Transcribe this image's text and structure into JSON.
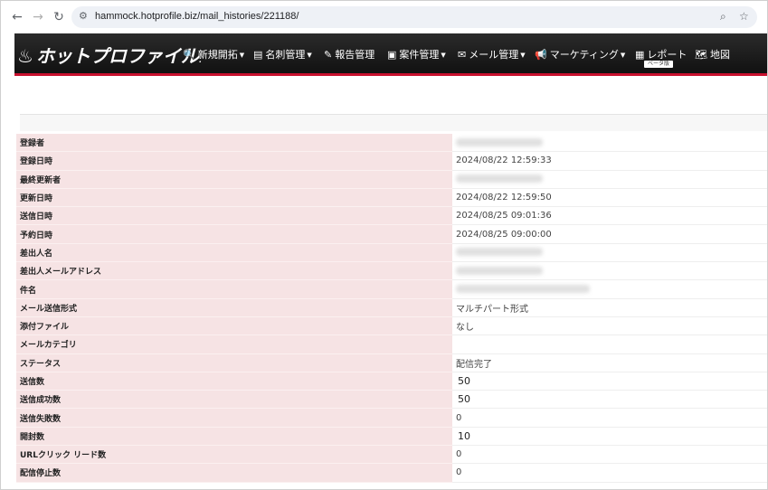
{
  "browser": {
    "url": "hammock.hotprofile.biz/mail_histories/221188/"
  },
  "app": {
    "logo": "ホットプロファイル",
    "menu": [
      {
        "label": "新規開拓",
        "icon": "search-doc-icon",
        "has_dropdown": true
      },
      {
        "label": "名刺管理",
        "icon": "card-icon",
        "has_dropdown": true
      },
      {
        "label": "報告管理",
        "icon": "edit-icon",
        "has_dropdown": false
      },
      {
        "label": "案件管理",
        "icon": "briefcase-icon",
        "has_dropdown": true
      },
      {
        "label": "メール管理",
        "icon": "mail-icon",
        "has_dropdown": true
      },
      {
        "label": "マーケティング",
        "icon": "megaphone-icon",
        "has_dropdown": true
      },
      {
        "label": "レポート",
        "icon": "table-icon",
        "has_dropdown": false
      },
      {
        "label": "地図",
        "icon": "map-icon",
        "has_dropdown": false
      }
    ],
    "beta_badge": "ベータ版",
    "accent_color": "#c8102e"
  },
  "detail_rows": [
    {
      "label": "登録者",
      "value": "",
      "blurred": true
    },
    {
      "label": "登録日時",
      "value": "2024/08/22 12:59:33",
      "blurred": false
    },
    {
      "label": "最終更新者",
      "value": "",
      "blurred": true
    },
    {
      "label": "更新日時",
      "value": "2024/08/22 12:59:50",
      "blurred": false
    },
    {
      "label": "送信日時",
      "value": "2024/08/25 09:01:36",
      "blurred": false
    },
    {
      "label": "予約日時",
      "value": "2024/08/25 09:00:00",
      "blurred": false
    },
    {
      "label": "差出人名",
      "value": "",
      "blurred": true
    },
    {
      "label": "差出人メールアドレス",
      "value": "",
      "blurred": true
    },
    {
      "label": "件名",
      "value": "",
      "blurred": true
    },
    {
      "label": "メール送信形式",
      "value": "マルチパート形式",
      "blurred": false
    },
    {
      "label": "添付ファイル",
      "value": "なし",
      "blurred": false
    },
    {
      "label": "メールカテゴリ",
      "value": "",
      "blurred": false
    },
    {
      "label": "ステータス",
      "value": "配信完了",
      "blurred": false
    },
    {
      "label": "送信数",
      "value": "50",
      "blurred": false,
      "big": true
    },
    {
      "label": "送信成功数",
      "value": "50",
      "blurred": false,
      "big": true
    },
    {
      "label": "送信失敗数",
      "value": "0",
      "blurred": false
    },
    {
      "label": "開封数",
      "value": "10",
      "blurred": false,
      "big": true
    },
    {
      "label": "URLクリック リード数",
      "value": "0",
      "blurred": false
    },
    {
      "label": "配信停止数",
      "value": "0",
      "blurred": false
    }
  ]
}
